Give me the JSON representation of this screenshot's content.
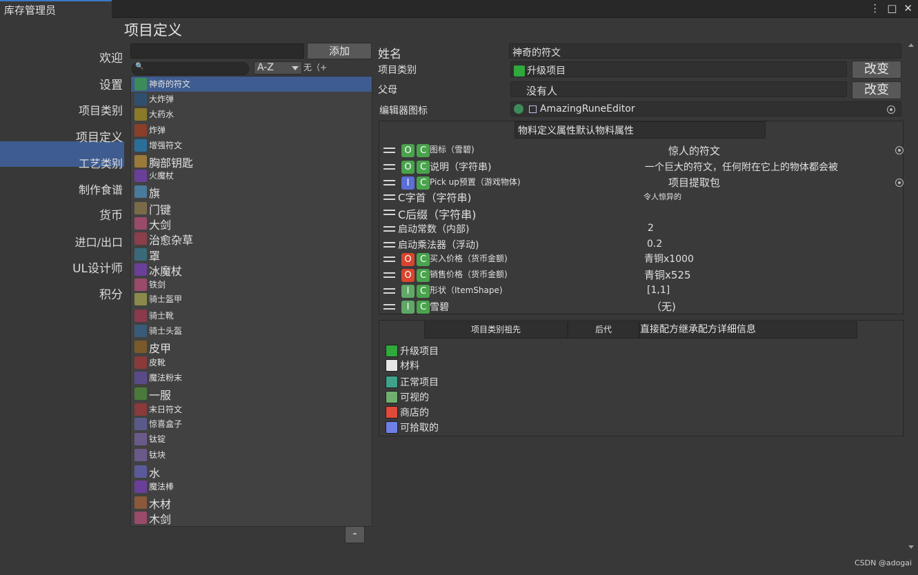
{
  "window": {
    "title": "库存管理员"
  },
  "nav": {
    "items": [
      "欢迎",
      "设置",
      "项目类别",
      "项目定义",
      "工艺类别",
      "制作食谱",
      "货币",
      "进口/出口",
      "UL设计师",
      "积分"
    ]
  },
  "page": {
    "title": "项目定义"
  },
  "left": {
    "add_label": "添加",
    "sort_value": "A-Z",
    "filter_text": "无（+",
    "minus_label": "-",
    "items": [
      {
        "label": "神奇的符文",
        "color": "#3c8c5a"
      },
      {
        "label": "大炸弹",
        "color": "#2f4f6f"
      },
      {
        "label": "大药水",
        "color": "#8a7a2a"
      },
      {
        "label": "炸弹",
        "color": "#8a3f2a"
      },
      {
        "label": "增强符文",
        "color": "#2a6f9a"
      },
      {
        "label": "胸部钥匙",
        "color": "#9a7a3a"
      },
      {
        "label": "火魔杖",
        "color": "#6a3f9a"
      },
      {
        "label": "旗",
        "color": "#4a7a9a"
      },
      {
        "label": "门键",
        "color": "#7a6a4a"
      },
      {
        "label": "大剑",
        "color": "#9a4a6a"
      },
      {
        "label": "治愈杂草",
        "color": "#8a3f4a"
      },
      {
        "label": "罩",
        "color": "#3a6a7a"
      },
      {
        "label": "冰魔杖",
        "color": "#6a3f9a"
      },
      {
        "label": "铁剑",
        "color": "#9a4a6a"
      },
      {
        "label": "骑士盔甲",
        "color": "#8a8a4a"
      },
      {
        "label": "骑士靴",
        "color": "#8a3a4a"
      },
      {
        "label": "骑士头盔",
        "color": "#3a5a7a"
      },
      {
        "label": "皮甲",
        "color": "#7a5a2a"
      },
      {
        "label": "皮靴",
        "color": "#8a3a3a"
      },
      {
        "label": "魔法粉末",
        "color": "#5a4a8a"
      },
      {
        "label": "一服",
        "color": "#4a7a3a"
      },
      {
        "label": "末日符文",
        "color": "#8a3a3a"
      },
      {
        "label": "惊喜盒子",
        "color": "#5a5a8a"
      },
      {
        "label": "钛锭",
        "color": "#6a5a8a"
      },
      {
        "label": "钛块",
        "color": "#6a5a8a"
      },
      {
        "label": "水",
        "color": "#5a5a9a"
      },
      {
        "label": "魔法棒",
        "color": "#6a3f9a"
      },
      {
        "label": "木材",
        "color": "#8a5a3a"
      },
      {
        "label": "木剑",
        "color": "#9a4a6a"
      }
    ]
  },
  "detail": {
    "name_label": "姓名",
    "name_value": "神奇的符文",
    "category_label": "项目类别",
    "category_value": "升级项目",
    "change_label": "改变",
    "parent_label": "父母",
    "parent_value": "没有人",
    "editor_icon_label": "编辑器图标",
    "editor_icon_value": "AmazingRuneEditor",
    "props_header": "物料定义属性默认物料属性"
  },
  "props": [
    {
      "badges": [
        {
          "t": "O",
          "c": "#49a34d"
        },
        {
          "t": "C",
          "c": "#49a34d"
        }
      ],
      "label": "图标（雪碧)",
      "value": "惊人的符文",
      "picker": true
    },
    {
      "badges": [
        {
          "t": "O",
          "c": "#49a34d"
        },
        {
          "t": "C",
          "c": "#49a34d"
        }
      ],
      "label": "说明（字符串)",
      "value": "一个巨大的符文，任何附在它上的物体都会被",
      "picker": false
    },
    {
      "badges": [
        {
          "t": "I",
          "c": "#5b6fd6"
        },
        {
          "t": "C",
          "c": "#49a34d"
        }
      ],
      "label": "Pick up预置（游戏物体)",
      "value": "项目提取包",
      "picker": true
    },
    {
      "badges": [],
      "label": "C字首（字符串)",
      "value": "令人惊异的",
      "picker": false
    },
    {
      "badges": [],
      "label": "C后缀（字符串)",
      "value": "",
      "picker": false
    },
    {
      "badges": [],
      "label": "启动常数（内部)",
      "value": "2",
      "picker": false
    },
    {
      "badges": [],
      "label": "启动乘法器（浮动)",
      "value": "0.2",
      "picker": false
    },
    {
      "badges": [
        {
          "t": "O",
          "c": "#d9452f"
        },
        {
          "t": "C",
          "c": "#49a34d"
        }
      ],
      "label": "买入价格（货币金额)",
      "value": "青铜x1000",
      "picker": false
    },
    {
      "badges": [
        {
          "t": "O",
          "c": "#d9452f"
        },
        {
          "t": "C",
          "c": "#49a34d"
        }
      ],
      "label": "销售价格（货币金额)",
      "value": "青铜x525",
      "picker": false
    },
    {
      "badges": [
        {
          "t": "I",
          "c": "#5fa867"
        },
        {
          "t": "C",
          "c": "#49a34d"
        }
      ],
      "label": "形状（ItemShape)",
      "value": "[1,1]",
      "picker": false
    },
    {
      "badges": [
        {
          "t": "I",
          "c": "#5fa867"
        },
        {
          "t": "C",
          "c": "#49a34d"
        }
      ],
      "label": "雪碧",
      "value": "（无)",
      "picker": false
    }
  ],
  "ancestors": {
    "tab_ancestors": "项目类别祖先",
    "tab_descendants": "后代",
    "tab_recipe": "直接配方继承配方详细信息",
    "items": [
      {
        "label": "升级项目",
        "color": "#2fa83c"
      },
      {
        "label": "材料",
        "color": "#e6e6e6"
      },
      {
        "label": "正常项目",
        "color": "#3fa38a"
      },
      {
        "label": "可视的",
        "color": "#6fb06f"
      },
      {
        "label": "商店的",
        "color": "#e04a3a"
      },
      {
        "label": "可拾取的",
        "color": "#6f7fe6"
      }
    ]
  },
  "credit": "CSDN @adogai"
}
